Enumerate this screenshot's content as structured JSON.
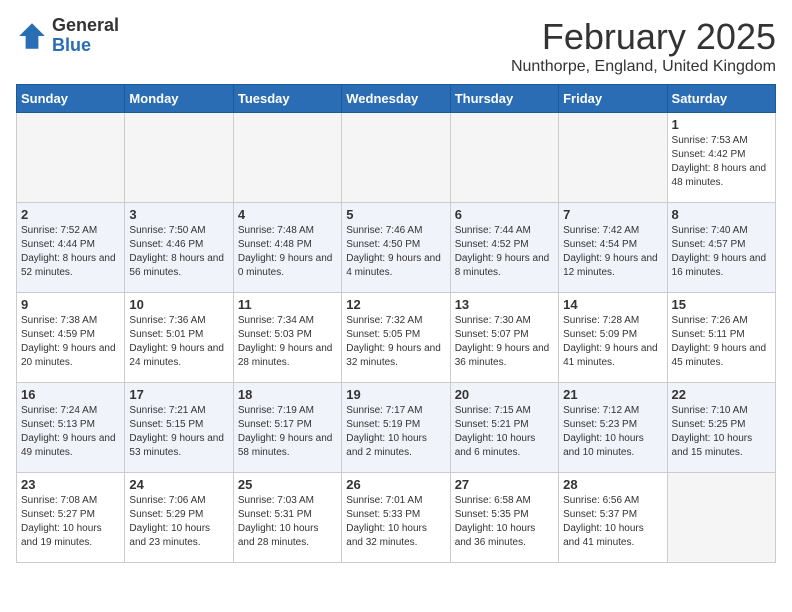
{
  "logo": {
    "general": "General",
    "blue": "Blue"
  },
  "header": {
    "month": "February 2025",
    "location": "Nunthorpe, England, United Kingdom"
  },
  "weekdays": [
    "Sunday",
    "Monday",
    "Tuesday",
    "Wednesday",
    "Thursday",
    "Friday",
    "Saturday"
  ],
  "weeks": [
    [
      {
        "day": "",
        "empty": true
      },
      {
        "day": "",
        "empty": true
      },
      {
        "day": "",
        "empty": true
      },
      {
        "day": "",
        "empty": true
      },
      {
        "day": "",
        "empty": true
      },
      {
        "day": "",
        "empty": true
      },
      {
        "day": "1",
        "sunrise": "7:53 AM",
        "sunset": "4:42 PM",
        "daylight": "8 hours and 48 minutes."
      }
    ],
    [
      {
        "day": "2",
        "sunrise": "7:52 AM",
        "sunset": "4:44 PM",
        "daylight": "8 hours and 52 minutes."
      },
      {
        "day": "3",
        "sunrise": "7:50 AM",
        "sunset": "4:46 PM",
        "daylight": "8 hours and 56 minutes."
      },
      {
        "day": "4",
        "sunrise": "7:48 AM",
        "sunset": "4:48 PM",
        "daylight": "9 hours and 0 minutes."
      },
      {
        "day": "5",
        "sunrise": "7:46 AM",
        "sunset": "4:50 PM",
        "daylight": "9 hours and 4 minutes."
      },
      {
        "day": "6",
        "sunrise": "7:44 AM",
        "sunset": "4:52 PM",
        "daylight": "9 hours and 8 minutes."
      },
      {
        "day": "7",
        "sunrise": "7:42 AM",
        "sunset": "4:54 PM",
        "daylight": "9 hours and 12 minutes."
      },
      {
        "day": "8",
        "sunrise": "7:40 AM",
        "sunset": "4:57 PM",
        "daylight": "9 hours and 16 minutes."
      }
    ],
    [
      {
        "day": "9",
        "sunrise": "7:38 AM",
        "sunset": "4:59 PM",
        "daylight": "9 hours and 20 minutes."
      },
      {
        "day": "10",
        "sunrise": "7:36 AM",
        "sunset": "5:01 PM",
        "daylight": "9 hours and 24 minutes."
      },
      {
        "day": "11",
        "sunrise": "7:34 AM",
        "sunset": "5:03 PM",
        "daylight": "9 hours and 28 minutes."
      },
      {
        "day": "12",
        "sunrise": "7:32 AM",
        "sunset": "5:05 PM",
        "daylight": "9 hours and 32 minutes."
      },
      {
        "day": "13",
        "sunrise": "7:30 AM",
        "sunset": "5:07 PM",
        "daylight": "9 hours and 36 minutes."
      },
      {
        "day": "14",
        "sunrise": "7:28 AM",
        "sunset": "5:09 PM",
        "daylight": "9 hours and 41 minutes."
      },
      {
        "day": "15",
        "sunrise": "7:26 AM",
        "sunset": "5:11 PM",
        "daylight": "9 hours and 45 minutes."
      }
    ],
    [
      {
        "day": "16",
        "sunrise": "7:24 AM",
        "sunset": "5:13 PM",
        "daylight": "9 hours and 49 minutes."
      },
      {
        "day": "17",
        "sunrise": "7:21 AM",
        "sunset": "5:15 PM",
        "daylight": "9 hours and 53 minutes."
      },
      {
        "day": "18",
        "sunrise": "7:19 AM",
        "sunset": "5:17 PM",
        "daylight": "9 hours and 58 minutes."
      },
      {
        "day": "19",
        "sunrise": "7:17 AM",
        "sunset": "5:19 PM",
        "daylight": "10 hours and 2 minutes."
      },
      {
        "day": "20",
        "sunrise": "7:15 AM",
        "sunset": "5:21 PM",
        "daylight": "10 hours and 6 minutes."
      },
      {
        "day": "21",
        "sunrise": "7:12 AM",
        "sunset": "5:23 PM",
        "daylight": "10 hours and 10 minutes."
      },
      {
        "day": "22",
        "sunrise": "7:10 AM",
        "sunset": "5:25 PM",
        "daylight": "10 hours and 15 minutes."
      }
    ],
    [
      {
        "day": "23",
        "sunrise": "7:08 AM",
        "sunset": "5:27 PM",
        "daylight": "10 hours and 19 minutes."
      },
      {
        "day": "24",
        "sunrise": "7:06 AM",
        "sunset": "5:29 PM",
        "daylight": "10 hours and 23 minutes."
      },
      {
        "day": "25",
        "sunrise": "7:03 AM",
        "sunset": "5:31 PM",
        "daylight": "10 hours and 28 minutes."
      },
      {
        "day": "26",
        "sunrise": "7:01 AM",
        "sunset": "5:33 PM",
        "daylight": "10 hours and 32 minutes."
      },
      {
        "day": "27",
        "sunrise": "6:58 AM",
        "sunset": "5:35 PM",
        "daylight": "10 hours and 36 minutes."
      },
      {
        "day": "28",
        "sunrise": "6:56 AM",
        "sunset": "5:37 PM",
        "daylight": "10 hours and 41 minutes."
      },
      {
        "day": "",
        "empty": true
      }
    ]
  ]
}
